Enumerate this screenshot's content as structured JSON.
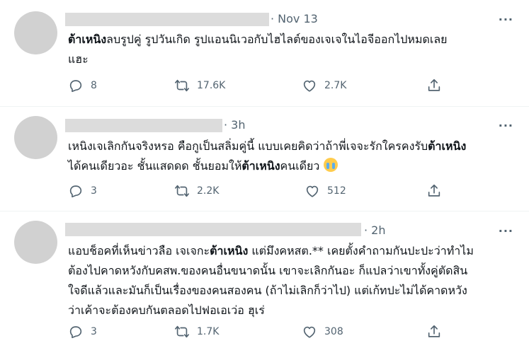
{
  "tweets": [
    {
      "time": "· Nov 13",
      "more": "···",
      "text_bold": "ต้าเหนิง",
      "text": "ลบรูปคู่ รูปวันเกิด รูปแอนนิเวอกับไฮไลต์ของเจเจในไอจีออกไปหมดเลย",
      "text2": "แฮะ",
      "replies": "8",
      "retweets": "17.6K",
      "likes": "2.7K"
    },
    {
      "time": "· 3h",
      "more": "···",
      "line1_a": "เหนิงเจเลิกกันจริงหรอ คือกูเป็นสลิ่มคู่นี้ แบบเคยคิดว่าถ้าพี่เจจะรักใครคงรับ",
      "line1_bold": "ต้าเหนิง",
      "line2_a": "ได้คนเดียวอะ ชั้นแสดดด ชั้นยอมให้",
      "line2_bold": "ต้าเหนิง",
      "line2_b": "คนเดียว",
      "emoji": "loudly-crying-face",
      "replies": "3",
      "retweets": "2.2K",
      "likes": "512"
    },
    {
      "time": "· 2h",
      "more": "···",
      "line1_a": "แอบช็อคที่เห็นข่าวลือ เจเจกะ",
      "line1_bold": "ต้าเหนิง",
      "line1_b": " แต่มึงคหสต.** เคยตั้งคำถามกันปะปะว่าทำไม",
      "line2": "ต้องไปคาดหวังกับคสพ.ของคนอื่นขนาดนั้น เขาจะเลิกกันอะ ก็แปลว่าเขาทั้งคู่ตัดสิน",
      "line3": "ใจดีแล้วและมันก็เป็นเรื่องของคนสองคน (ถ้าไม่เลิกก็ว่าไป) แต่เก้ทปะไม่ได้คาดหวัง",
      "line4": "ว่าเค้าจะต้องคบกันตลอดไปฟอเอเว่อ ฮุเร่",
      "replies": "3",
      "retweets": "1.7K",
      "likes": "308"
    }
  ],
  "icons": {
    "reply": "reply-icon",
    "retweet": "retweet-icon",
    "like": "like-icon",
    "share": "share-icon"
  }
}
